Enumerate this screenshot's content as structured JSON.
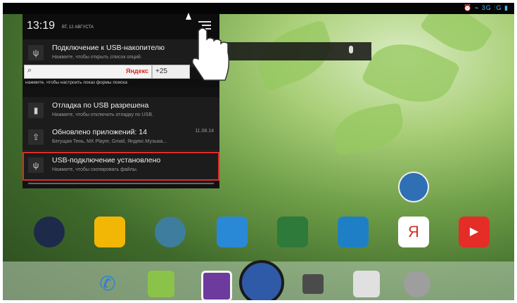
{
  "status_bar": {
    "icons_text": "⏰ ⌁ 3G ⫶G ▮"
  },
  "notification_shade": {
    "time": "13:19",
    "date": "ВТ, 12 АВГУСТА",
    "notifications": [
      {
        "icon": "usb-icon",
        "title": "Подключение к USB-накопителю",
        "subtitle": "Нажмите, чтобы открыть список опций.",
        "time": ""
      },
      {
        "icon": "debug-icon",
        "title": "Отладка по USB разрешена",
        "subtitle": "Нажмите, чтобы отключить отладку по USB.",
        "time": ""
      },
      {
        "icon": "update-icon",
        "title": "Обновлено приложений: 14",
        "subtitle": "Бегущая Тень, MX Player, Gmail, Яндекс.Музыка...",
        "time": "11.08.14"
      },
      {
        "icon": "usb-icon",
        "title": "USB-подключение установлено",
        "subtitle": "Нажмите, чтобы скопировать файлы.",
        "time": ""
      }
    ],
    "search_hint": "нажмите, чтобы настроить показ формы поиска"
  },
  "widgets": {
    "search_brand": "Яндекс",
    "weather": "+25"
  },
  "home": {
    "apps": [
      {
        "icon": "speaker-icon",
        "label": "",
        "color": "#1d2a4a"
      },
      {
        "icon": "taxi-icon",
        "label": "",
        "color": "#f2b705"
      },
      {
        "icon": "ufo-icon",
        "label": "",
        "color": "#3f7d9e"
      },
      {
        "icon": "volume-icon",
        "label": "",
        "color": "#2a89d6"
      },
      {
        "icon": "file-manager-icon",
        "label": "",
        "color": "#2d7a3a"
      },
      {
        "icon": "es-explorer-icon",
        "label": "",
        "color": "#1f7fc6"
      },
      {
        "icon": "yandex-icon",
        "label": "",
        "color": "#ffffff"
      },
      {
        "icon": "youtube-icon",
        "label": "",
        "color": "#e52d27"
      }
    ],
    "dock": [
      {
        "icon": "phone-icon",
        "color": "#2b7fd6"
      },
      {
        "icon": "sms-icon",
        "color": "#8bc34a"
      },
      {
        "icon": "gallery-icon",
        "color": "#6d3a9e"
      },
      {
        "icon": "app-drawer-icon",
        "color": "#2e5aa8"
      },
      {
        "icon": "camera-icon",
        "color": "#4b4b4b"
      },
      {
        "icon": "play-store-icon",
        "color": "#e0e0e0"
      },
      {
        "icon": "settings-icon",
        "color": "#9e9e9e"
      }
    ]
  }
}
